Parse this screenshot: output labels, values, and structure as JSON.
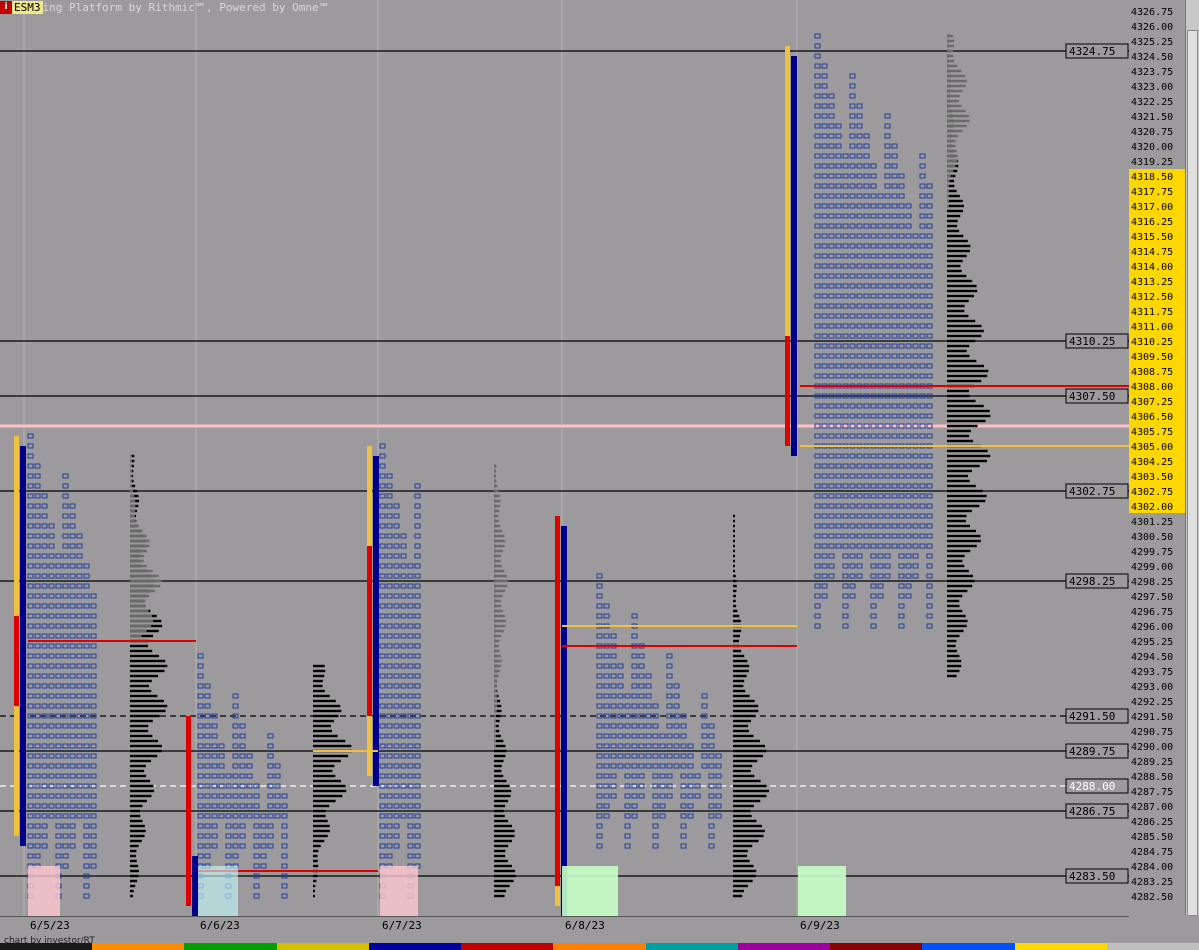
{
  "app": {
    "title": "ing Platform by Rithmic℠, Powered by Omne℠",
    "symbol": "ESM3",
    "left_icon": "i",
    "right_icon": "M",
    "bottom_caption": "chart by investor/RT"
  },
  "chart_data": {
    "type": "market-profile",
    "price_axis": {
      "min": 4282.5,
      "max": 4326.75,
      "tick": 0.75,
      "highlight_range": [
        4302.0,
        4318.5
      ],
      "highlight_color": "#ffd700"
    },
    "reference_lines": [
      {
        "price": 4324.75,
        "label": "4324.75",
        "style": "solid"
      },
      {
        "price": 4310.25,
        "label": "4310.25",
        "style": "solid"
      },
      {
        "price": 4307.5,
        "label": "4307.50",
        "style": "solid"
      },
      {
        "price": 4302.75,
        "label": "4302.75",
        "style": "solid"
      },
      {
        "price": 4298.25,
        "label": "4298.25",
        "style": "solid"
      },
      {
        "price": 4291.5,
        "label": "4291.50",
        "style": "dashed"
      },
      {
        "price": 4289.75,
        "label": "4289.75",
        "style": "solid"
      },
      {
        "price": 4288.0,
        "label": "4288.00",
        "style": "dashed-white"
      },
      {
        "price": 4286.75,
        "label": "4286.75",
        "style": "solid"
      },
      {
        "price": 4283.5,
        "label": "4283.50",
        "style": "solid"
      }
    ],
    "pink_line_price": 4306.0,
    "sessions": [
      {
        "date": "6/5/23",
        "high": 4305.75,
        "low": 4282.0,
        "poc": 4295.25,
        "vah": 4304.5,
        "val": 4286.0,
        "value_color": "#ffd700"
      },
      {
        "date": "6/6/23",
        "high": 4295.0,
        "low": 4282.0,
        "poc": 4283.75,
        "vah": 4289.75,
        "val": 4282.0
      },
      {
        "date": "6/7/23",
        "high": 4305.0,
        "low": 4282.0,
        "poc": 4283.75,
        "vah": 4289.75,
        "val": 4286.75
      },
      {
        "date": "6/8/23",
        "high": 4301.75,
        "low": 4282.0,
        "poc": 4295.0,
        "vah": 4296.0,
        "val": 4283.5
      },
      {
        "date": "6/9/23",
        "high": 4325.75,
        "low": 4294.25,
        "poc": 4308.0,
        "vah": 4305.0,
        "val": 4306.0
      }
    ]
  }
}
